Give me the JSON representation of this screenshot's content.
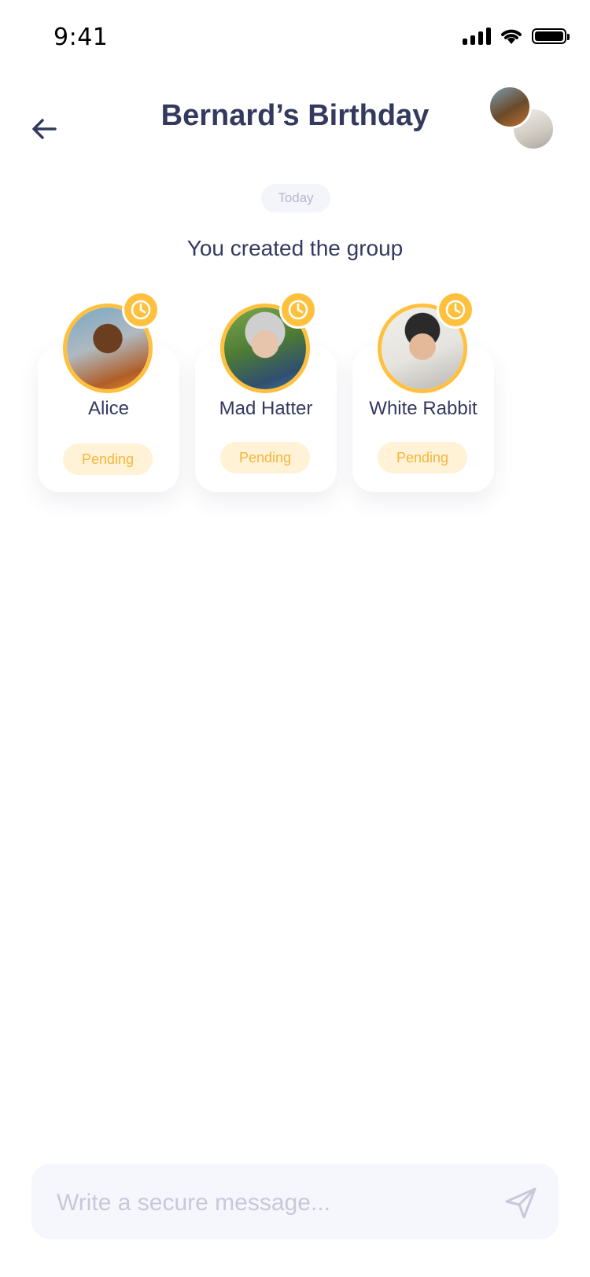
{
  "status_bar": {
    "time": "9:41",
    "signal_icon": "cellular-signal-icon",
    "wifi_icon": "wifi-icon",
    "battery_icon": "battery-icon"
  },
  "header": {
    "title": "Bernard’s Birthday",
    "back_icon": "back-arrow-icon",
    "group_avatars": [
      "avatar-1",
      "avatar-2"
    ]
  },
  "conversation": {
    "date_label": "Today",
    "system_message": "You created the group"
  },
  "members": [
    {
      "name": "Alice",
      "status": "Pending",
      "status_icon": "clock-icon"
    },
    {
      "name": "Mad Hatter",
      "status": "Pending",
      "status_icon": "clock-icon"
    },
    {
      "name": "White Rabbit",
      "status": "Pending",
      "status_icon": "clock-icon"
    }
  ],
  "composer": {
    "placeholder": "Write a secure message...",
    "value": "",
    "send_icon": "send-icon"
  },
  "colors": {
    "text_primary": "#34395e",
    "accent_pending": "#ffc13d",
    "pending_chip_bg": "#fff2d6",
    "pending_chip_text": "#f6b63c",
    "composer_bg": "#f6f6fd"
  }
}
